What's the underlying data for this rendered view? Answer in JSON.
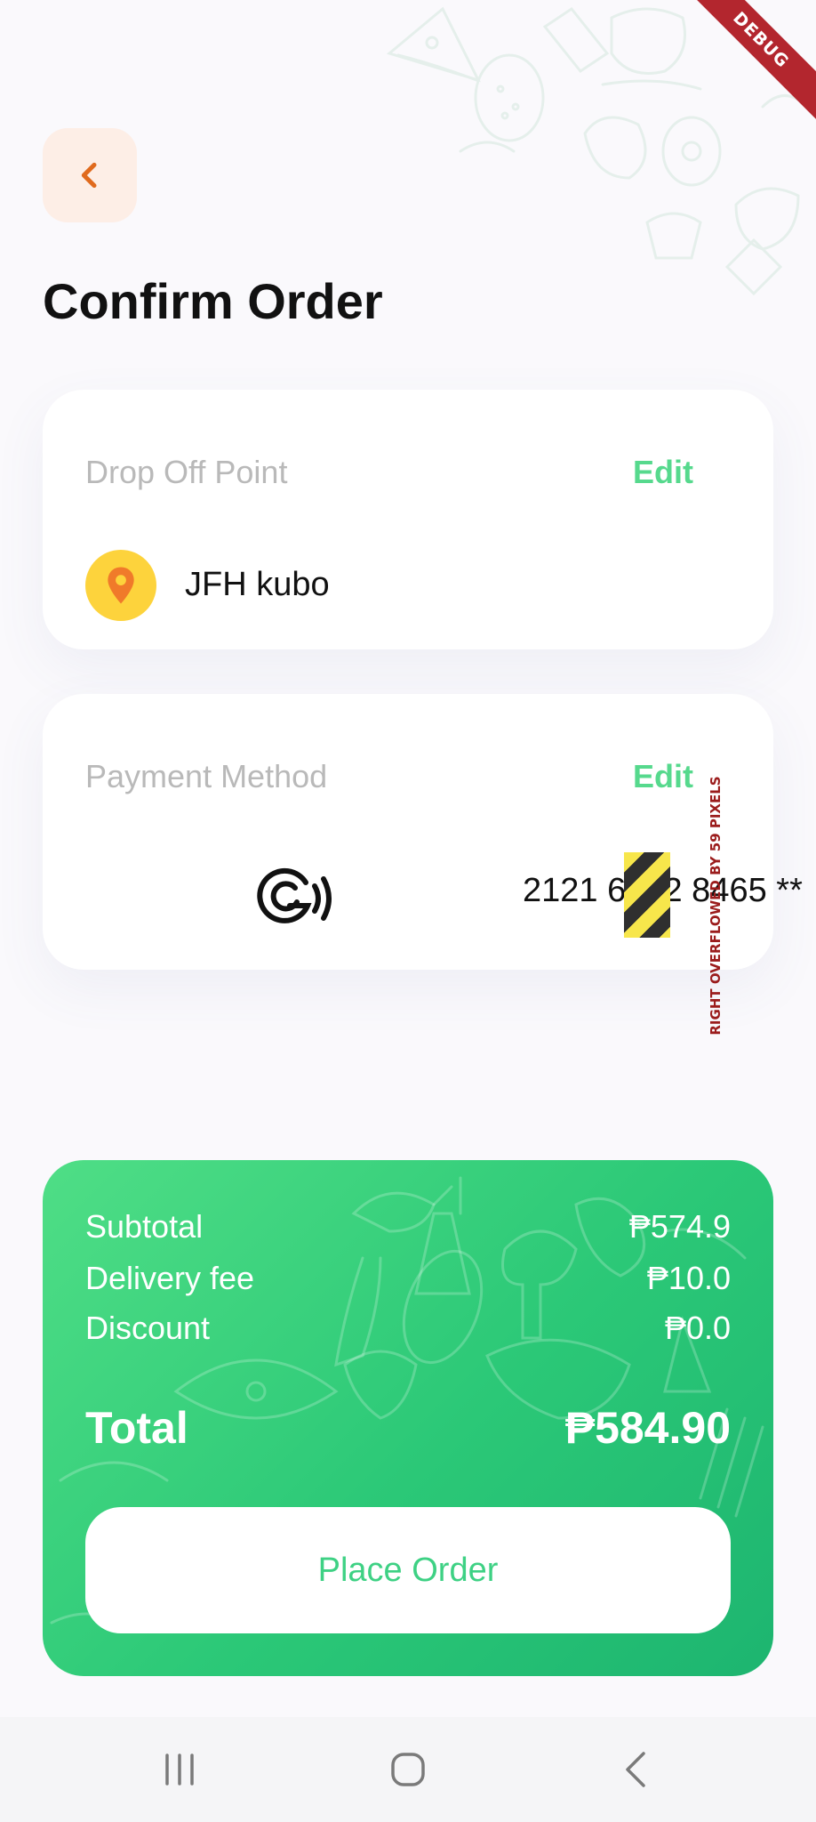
{
  "debug_banner": "DEBUG",
  "header": {
    "back_icon": "chevron-left-icon",
    "title": "Confirm Order"
  },
  "drop_off": {
    "label": "Drop Off Point",
    "edit_label": "Edit",
    "icon": "location-pin-icon",
    "address": "JFH kubo"
  },
  "payment": {
    "label": "Payment Method",
    "edit_label": "Edit",
    "icon": "gcash-logo-icon",
    "number": "2121 6352 8465 **"
  },
  "overflow_warning": "RIGHT OVERFLOWED BY 59 PIXELS",
  "summary": {
    "subtotal_label": "Subtotal",
    "subtotal_value": "₱574.9",
    "delivery_label": "Delivery fee",
    "delivery_value": "₱10.0",
    "discount_label": "Discount",
    "discount_value": "₱0.0",
    "total_label": "Total",
    "total_value": "₱584.90",
    "place_order_label": "Place Order"
  },
  "navbar": {
    "recents_icon": "recents-icon",
    "home_icon": "home-icon",
    "back_icon": "back-icon"
  },
  "colors": {
    "accent_green": "#56d98d",
    "summary_green": "#2bc877",
    "back_button_bg": "#fdeee6",
    "back_icon": "#e06a1d",
    "pin_yellow": "#fdd33c",
    "pin_orange": "#f07a2a"
  }
}
